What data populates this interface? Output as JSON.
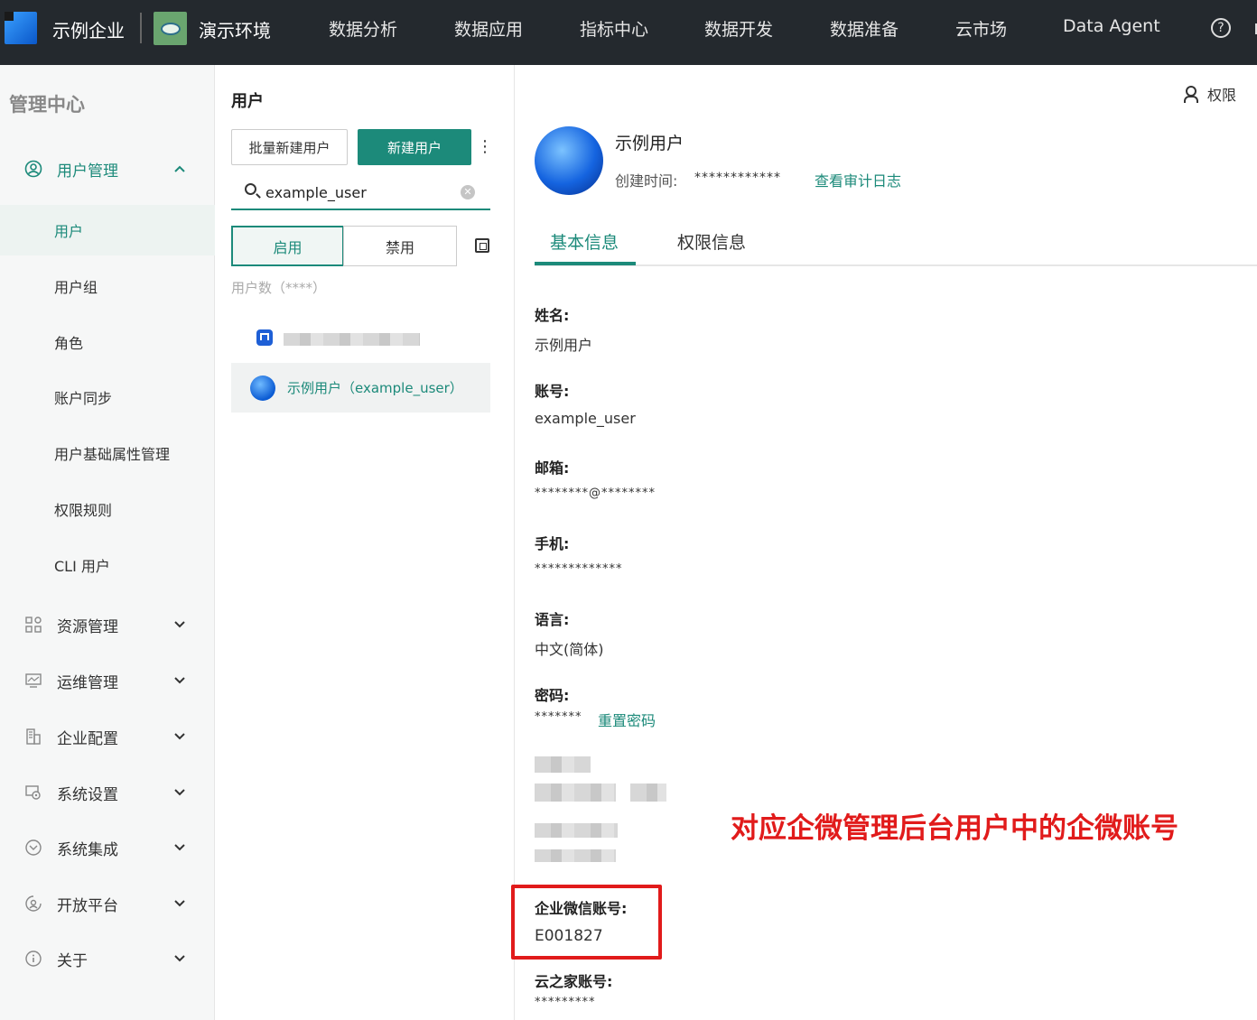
{
  "topbar": {
    "enterprise_name": "示例企业",
    "env_name": "演示环境",
    "nav": [
      "数据分析",
      "数据应用",
      "指标中心",
      "数据开发",
      "数据准备",
      "云市场",
      "Data Agent"
    ],
    "help_symbol": "?"
  },
  "sidebar": {
    "title": "管理中心",
    "groups": [
      {
        "label": "用户管理",
        "icon": "user-circle-icon",
        "expanded": true
      },
      {
        "label": "资源管理",
        "icon": "grid-icon"
      },
      {
        "label": "运维管理",
        "icon": "monitor-icon"
      },
      {
        "label": "企业配置",
        "icon": "building-icon"
      },
      {
        "label": "系统设置",
        "icon": "settings-icon"
      },
      {
        "label": "系统集成",
        "icon": "integration-icon"
      },
      {
        "label": "开放平台",
        "icon": "open-platform-icon"
      },
      {
        "label": "关于",
        "icon": "info-icon"
      }
    ],
    "sub_items": [
      "用户",
      "用户组",
      "角色",
      "账户同步",
      "用户基础属性管理",
      "权限规则",
      "CLI 用户"
    ],
    "active_sub_index": 0
  },
  "users_panel": {
    "title": "用户",
    "batch_create_label": "批量新建用户",
    "create_label": "新建用户",
    "search_value": "example_user",
    "enable_label": "启用",
    "disable_label": "禁用",
    "user_count_label": "用户数（****）",
    "selected_user_label": "示例用户（example_user）"
  },
  "detail": {
    "permission_link": "权限",
    "display_name": "示例用户",
    "created_label": "创建时间:",
    "created_value": "************",
    "audit_link": "查看审计日志",
    "tabs": [
      "基本信息",
      "权限信息"
    ],
    "active_tab": 0,
    "fields": {
      "name_label": "姓名:",
      "name_value": "示例用户",
      "account_label": "账号:",
      "account_value": "example_user",
      "email_label": "邮箱:",
      "email_value": "********@********",
      "phone_label": "手机:",
      "phone_value": "*************",
      "language_label": "语言:",
      "language_value": "中文(简体)",
      "password_label": "密码:",
      "password_value": "*******",
      "reset_password": "重置密码",
      "wecom_label": "企业微信账号:",
      "wecom_value": "E001827",
      "yzj_label": "云之家账号:",
      "yzj_value": "*********"
    },
    "annotation": "对应企微管理后台用户中的企微账号",
    "accent_color": "#1c8a7a",
    "annotation_color": "#e11b1b"
  }
}
